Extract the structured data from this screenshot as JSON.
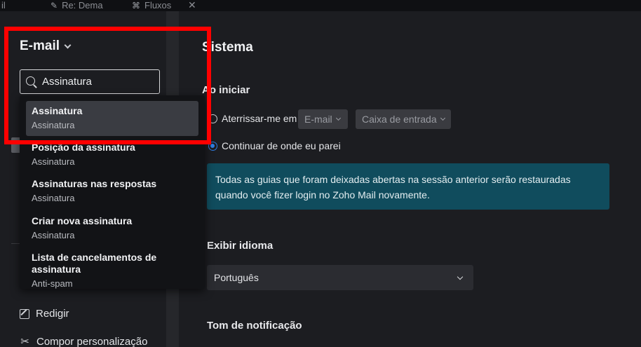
{
  "tabs": [
    {
      "label": "il"
    },
    {
      "label": "Re: Dema",
      "icon": "pencil-icon"
    },
    {
      "label": "Fluxos",
      "icon": "flows-icon"
    }
  ],
  "sidebar": {
    "title": "E-mail",
    "search": {
      "value": "Assinatura",
      "placeholder": ""
    },
    "items": [
      {
        "label": "Redigir",
        "icon": "compose-icon"
      },
      {
        "label": "Compor personalização",
        "icon": "tools-icon"
      }
    ]
  },
  "dropdown": {
    "results": [
      {
        "title": "Assinatura",
        "category": "Assinatura"
      },
      {
        "title": "Posição da assinatura",
        "category": "Assinatura"
      },
      {
        "title": "Assinaturas nas respostas",
        "category": "Assinatura"
      },
      {
        "title": "Criar nova assinatura",
        "category": "Assinatura"
      },
      {
        "title": "Lista de cancelamentos de assinatura",
        "category": "Anti-spam"
      }
    ]
  },
  "main": {
    "section_title": "Sistema",
    "on_start": {
      "heading": "Ao iniciar",
      "option_land": "Aterrissar-me em",
      "land_module": "E-mail",
      "land_folder": "Caixa de entrada",
      "option_continue": "Continuar de onde eu parei",
      "selected": "continue",
      "info": "Todas as guias que foram deixadas abertas na sessão anterior serão restauradas quando você fizer login no Zoho Mail novamente."
    },
    "language": {
      "heading": "Exibir idioma",
      "value": "Português"
    },
    "notification": {
      "heading": "Tom de notificação"
    }
  },
  "colors": {
    "highlight": "#ff0000",
    "info_box": "#104c5d",
    "radio_accent": "#2f7de1",
    "background": "#1c1d21"
  }
}
